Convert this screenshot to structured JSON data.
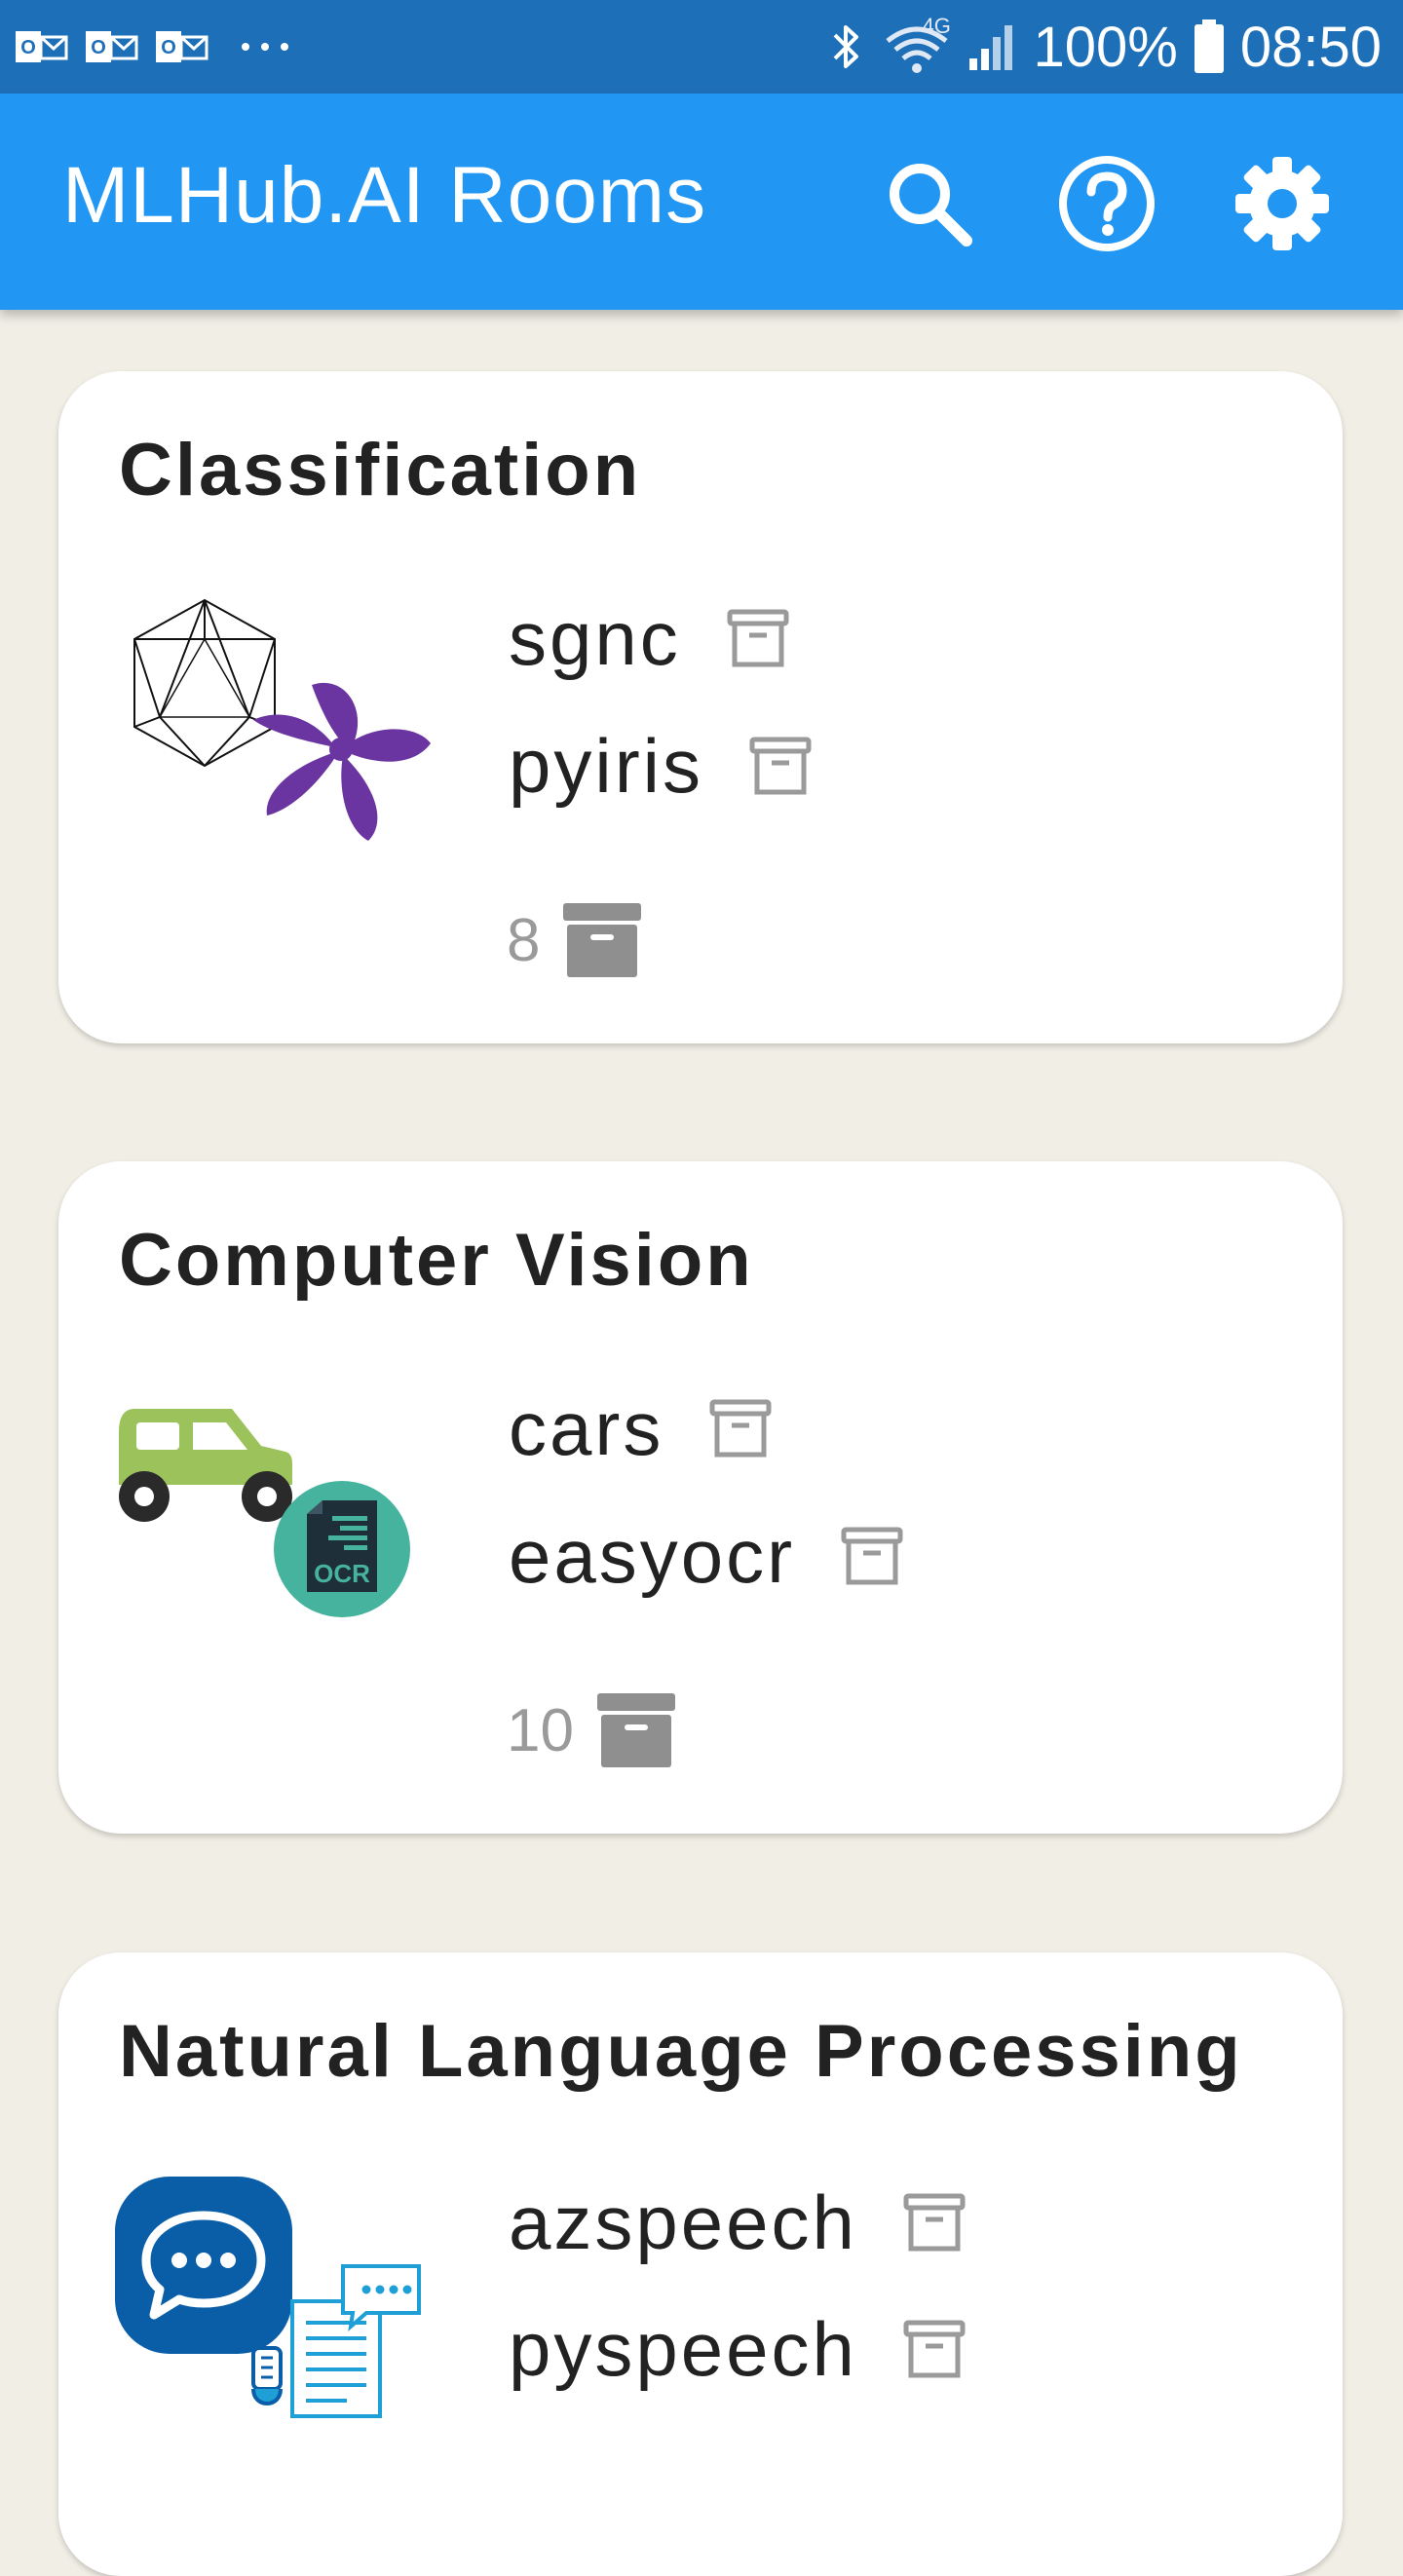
{
  "status_bar": {
    "battery": "100%",
    "time": "08:50",
    "network": "4G",
    "left_icons": [
      "outlook-icon",
      "outlook-icon",
      "outlook-icon",
      "more-dots-icon"
    ],
    "right_icons": [
      "bluetooth-icon",
      "wifi-icon",
      "signal-icon",
      "battery-icon"
    ]
  },
  "app_bar": {
    "title": "MLHub.AI Rooms",
    "actions": [
      "search-icon",
      "help-icon",
      "settings-icon"
    ],
    "color": "#2196f3"
  },
  "rooms": [
    {
      "title": "Classification",
      "apps": [
        {
          "name": "sgnc",
          "icon": "archive-outline-icon"
        },
        {
          "name": "pyiris",
          "icon": "archive-outline-icon"
        }
      ],
      "count": "8",
      "count_icon": "archive-filled-icon",
      "images": [
        "icosahedron-icon",
        "iris-flower-icon"
      ]
    },
    {
      "title": "Computer Vision",
      "apps": [
        {
          "name": "cars",
          "icon": "archive-outline-icon"
        },
        {
          "name": "easyocr",
          "icon": "archive-outline-icon"
        }
      ],
      "count": "10",
      "count_icon": "archive-filled-icon",
      "images": [
        "car-icon",
        "ocr-icon"
      ]
    },
    {
      "title": "Natural Language Processing",
      "apps": [
        {
          "name": "azspeech",
          "icon": "archive-outline-icon"
        },
        {
          "name": "pyspeech",
          "icon": "archive-outline-icon"
        }
      ],
      "images": [
        "chat-bubble-icon",
        "speech-document-icon"
      ]
    }
  ],
  "colors": {
    "status_bar": "#1d6fb8",
    "app_bar": "#2196f3",
    "background": "#f0eee5",
    "card": "#ffffff",
    "muted": "#9a9a9a"
  }
}
